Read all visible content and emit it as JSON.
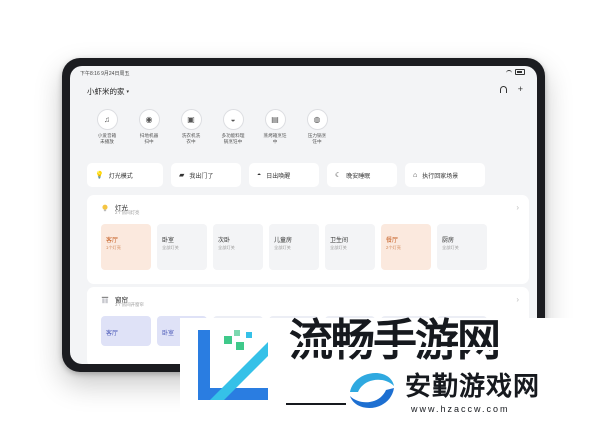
{
  "status": {
    "time": "下午8:16",
    "date": "9月24日周五"
  },
  "header": {
    "home_name": "小虾米的家",
    "caret": "▾",
    "add_icon": "+"
  },
  "devices": [
    {
      "icon": "speaker-icon",
      "glyph": "♫",
      "label": "小爱音箱\n未播放"
    },
    {
      "icon": "robot-vacuum-icon",
      "glyph": "◉",
      "label": "扫地机器\n扫中"
    },
    {
      "icon": "washer-icon",
      "glyph": "▣",
      "label": "洗衣机洗\n衣中"
    },
    {
      "icon": "cooker-icon",
      "glyph": "◒",
      "label": "多功能料理\n锅烹饪中"
    },
    {
      "icon": "oven-icon",
      "glyph": "▤",
      "label": "蒸烤箱烹饪\n中"
    },
    {
      "icon": "pressure-cooker-icon",
      "glyph": "◍",
      "label": "压力锅烹\n饪中"
    }
  ],
  "scenes": [
    {
      "icon": "bulb-icon",
      "glyph": "💡",
      "label": "灯光模式",
      "width": 76
    },
    {
      "icon": "door-icon",
      "glyph": "▰",
      "label": "我出门了",
      "width": 70
    },
    {
      "icon": "sunrise-icon",
      "glyph": "◓",
      "label": "日出唤醒",
      "width": 70
    },
    {
      "icon": "moon-icon",
      "glyph": "☾",
      "label": "晚安睡眠",
      "width": 70
    },
    {
      "icon": "home-icon",
      "glyph": "⌂",
      "label": "执行回家场景",
      "width": 80
    }
  ],
  "light_card": {
    "title": "灯光",
    "subtitle": "2个房间灯亮",
    "rooms": [
      {
        "name": "客厅",
        "status": "1个灯亮",
        "on": true
      },
      {
        "name": "卧室",
        "status": "全部灯关",
        "on": false
      },
      {
        "name": "次卧",
        "status": "全部灯关",
        "on": false
      },
      {
        "name": "儿童房",
        "status": "全部灯关",
        "on": false
      },
      {
        "name": "卫生间",
        "status": "全部灯关",
        "on": false
      },
      {
        "name": "餐厅",
        "status": "2个灯亮",
        "on": true
      },
      {
        "name": "厨房",
        "status": "全部灯关",
        "on": false
      }
    ]
  },
  "curtain_card": {
    "title": "窗帘",
    "subtitle": "3个房间开窗帘",
    "rooms": [
      {
        "name": "客厅",
        "on": true
      },
      {
        "name": "卧室",
        "on": true
      },
      {
        "name": "",
        "on": false
      },
      {
        "name": "",
        "on": false
      },
      {
        "name": "",
        "on": false
      },
      {
        "name": "",
        "on": false
      },
      {
        "name": "",
        "on": false
      }
    ]
  },
  "watermark": {
    "big_text": "流畅手游网",
    "brand": "安勤游戏网",
    "url": "www.hzaccw.com"
  },
  "colors": {
    "accent": "#c65d20",
    "room_on": "#fbe9de",
    "screen_bg": "#f3f4f6"
  }
}
